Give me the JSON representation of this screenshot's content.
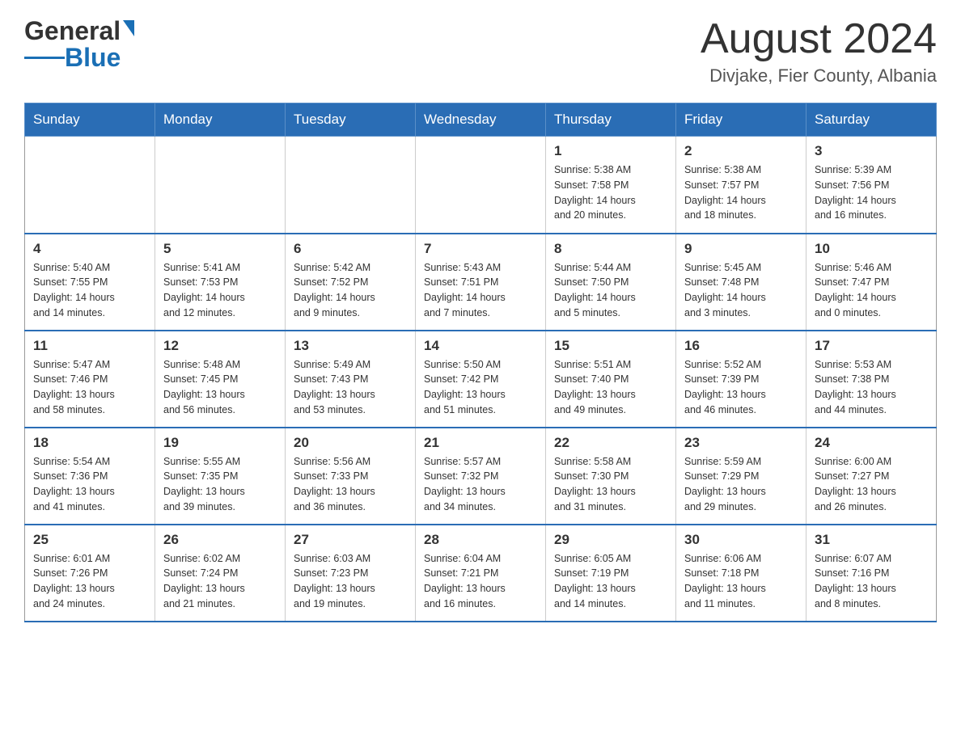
{
  "header": {
    "logo_text_black": "General",
    "logo_text_blue": "Blue",
    "month_year": "August 2024",
    "location": "Divjake, Fier County, Albania"
  },
  "days_of_week": [
    "Sunday",
    "Monday",
    "Tuesday",
    "Wednesday",
    "Thursday",
    "Friday",
    "Saturday"
  ],
  "weeks": [
    [
      {
        "day": "",
        "info": ""
      },
      {
        "day": "",
        "info": ""
      },
      {
        "day": "",
        "info": ""
      },
      {
        "day": "",
        "info": ""
      },
      {
        "day": "1",
        "info": "Sunrise: 5:38 AM\nSunset: 7:58 PM\nDaylight: 14 hours\nand 20 minutes."
      },
      {
        "day": "2",
        "info": "Sunrise: 5:38 AM\nSunset: 7:57 PM\nDaylight: 14 hours\nand 18 minutes."
      },
      {
        "day": "3",
        "info": "Sunrise: 5:39 AM\nSunset: 7:56 PM\nDaylight: 14 hours\nand 16 minutes."
      }
    ],
    [
      {
        "day": "4",
        "info": "Sunrise: 5:40 AM\nSunset: 7:55 PM\nDaylight: 14 hours\nand 14 minutes."
      },
      {
        "day": "5",
        "info": "Sunrise: 5:41 AM\nSunset: 7:53 PM\nDaylight: 14 hours\nand 12 minutes."
      },
      {
        "day": "6",
        "info": "Sunrise: 5:42 AM\nSunset: 7:52 PM\nDaylight: 14 hours\nand 9 minutes."
      },
      {
        "day": "7",
        "info": "Sunrise: 5:43 AM\nSunset: 7:51 PM\nDaylight: 14 hours\nand 7 minutes."
      },
      {
        "day": "8",
        "info": "Sunrise: 5:44 AM\nSunset: 7:50 PM\nDaylight: 14 hours\nand 5 minutes."
      },
      {
        "day": "9",
        "info": "Sunrise: 5:45 AM\nSunset: 7:48 PM\nDaylight: 14 hours\nand 3 minutes."
      },
      {
        "day": "10",
        "info": "Sunrise: 5:46 AM\nSunset: 7:47 PM\nDaylight: 14 hours\nand 0 minutes."
      }
    ],
    [
      {
        "day": "11",
        "info": "Sunrise: 5:47 AM\nSunset: 7:46 PM\nDaylight: 13 hours\nand 58 minutes."
      },
      {
        "day": "12",
        "info": "Sunrise: 5:48 AM\nSunset: 7:45 PM\nDaylight: 13 hours\nand 56 minutes."
      },
      {
        "day": "13",
        "info": "Sunrise: 5:49 AM\nSunset: 7:43 PM\nDaylight: 13 hours\nand 53 minutes."
      },
      {
        "day": "14",
        "info": "Sunrise: 5:50 AM\nSunset: 7:42 PM\nDaylight: 13 hours\nand 51 minutes."
      },
      {
        "day": "15",
        "info": "Sunrise: 5:51 AM\nSunset: 7:40 PM\nDaylight: 13 hours\nand 49 minutes."
      },
      {
        "day": "16",
        "info": "Sunrise: 5:52 AM\nSunset: 7:39 PM\nDaylight: 13 hours\nand 46 minutes."
      },
      {
        "day": "17",
        "info": "Sunrise: 5:53 AM\nSunset: 7:38 PM\nDaylight: 13 hours\nand 44 minutes."
      }
    ],
    [
      {
        "day": "18",
        "info": "Sunrise: 5:54 AM\nSunset: 7:36 PM\nDaylight: 13 hours\nand 41 minutes."
      },
      {
        "day": "19",
        "info": "Sunrise: 5:55 AM\nSunset: 7:35 PM\nDaylight: 13 hours\nand 39 minutes."
      },
      {
        "day": "20",
        "info": "Sunrise: 5:56 AM\nSunset: 7:33 PM\nDaylight: 13 hours\nand 36 minutes."
      },
      {
        "day": "21",
        "info": "Sunrise: 5:57 AM\nSunset: 7:32 PM\nDaylight: 13 hours\nand 34 minutes."
      },
      {
        "day": "22",
        "info": "Sunrise: 5:58 AM\nSunset: 7:30 PM\nDaylight: 13 hours\nand 31 minutes."
      },
      {
        "day": "23",
        "info": "Sunrise: 5:59 AM\nSunset: 7:29 PM\nDaylight: 13 hours\nand 29 minutes."
      },
      {
        "day": "24",
        "info": "Sunrise: 6:00 AM\nSunset: 7:27 PM\nDaylight: 13 hours\nand 26 minutes."
      }
    ],
    [
      {
        "day": "25",
        "info": "Sunrise: 6:01 AM\nSunset: 7:26 PM\nDaylight: 13 hours\nand 24 minutes."
      },
      {
        "day": "26",
        "info": "Sunrise: 6:02 AM\nSunset: 7:24 PM\nDaylight: 13 hours\nand 21 minutes."
      },
      {
        "day": "27",
        "info": "Sunrise: 6:03 AM\nSunset: 7:23 PM\nDaylight: 13 hours\nand 19 minutes."
      },
      {
        "day": "28",
        "info": "Sunrise: 6:04 AM\nSunset: 7:21 PM\nDaylight: 13 hours\nand 16 minutes."
      },
      {
        "day": "29",
        "info": "Sunrise: 6:05 AM\nSunset: 7:19 PM\nDaylight: 13 hours\nand 14 minutes."
      },
      {
        "day": "30",
        "info": "Sunrise: 6:06 AM\nSunset: 7:18 PM\nDaylight: 13 hours\nand 11 minutes."
      },
      {
        "day": "31",
        "info": "Sunrise: 6:07 AM\nSunset: 7:16 PM\nDaylight: 13 hours\nand 8 minutes."
      }
    ]
  ]
}
